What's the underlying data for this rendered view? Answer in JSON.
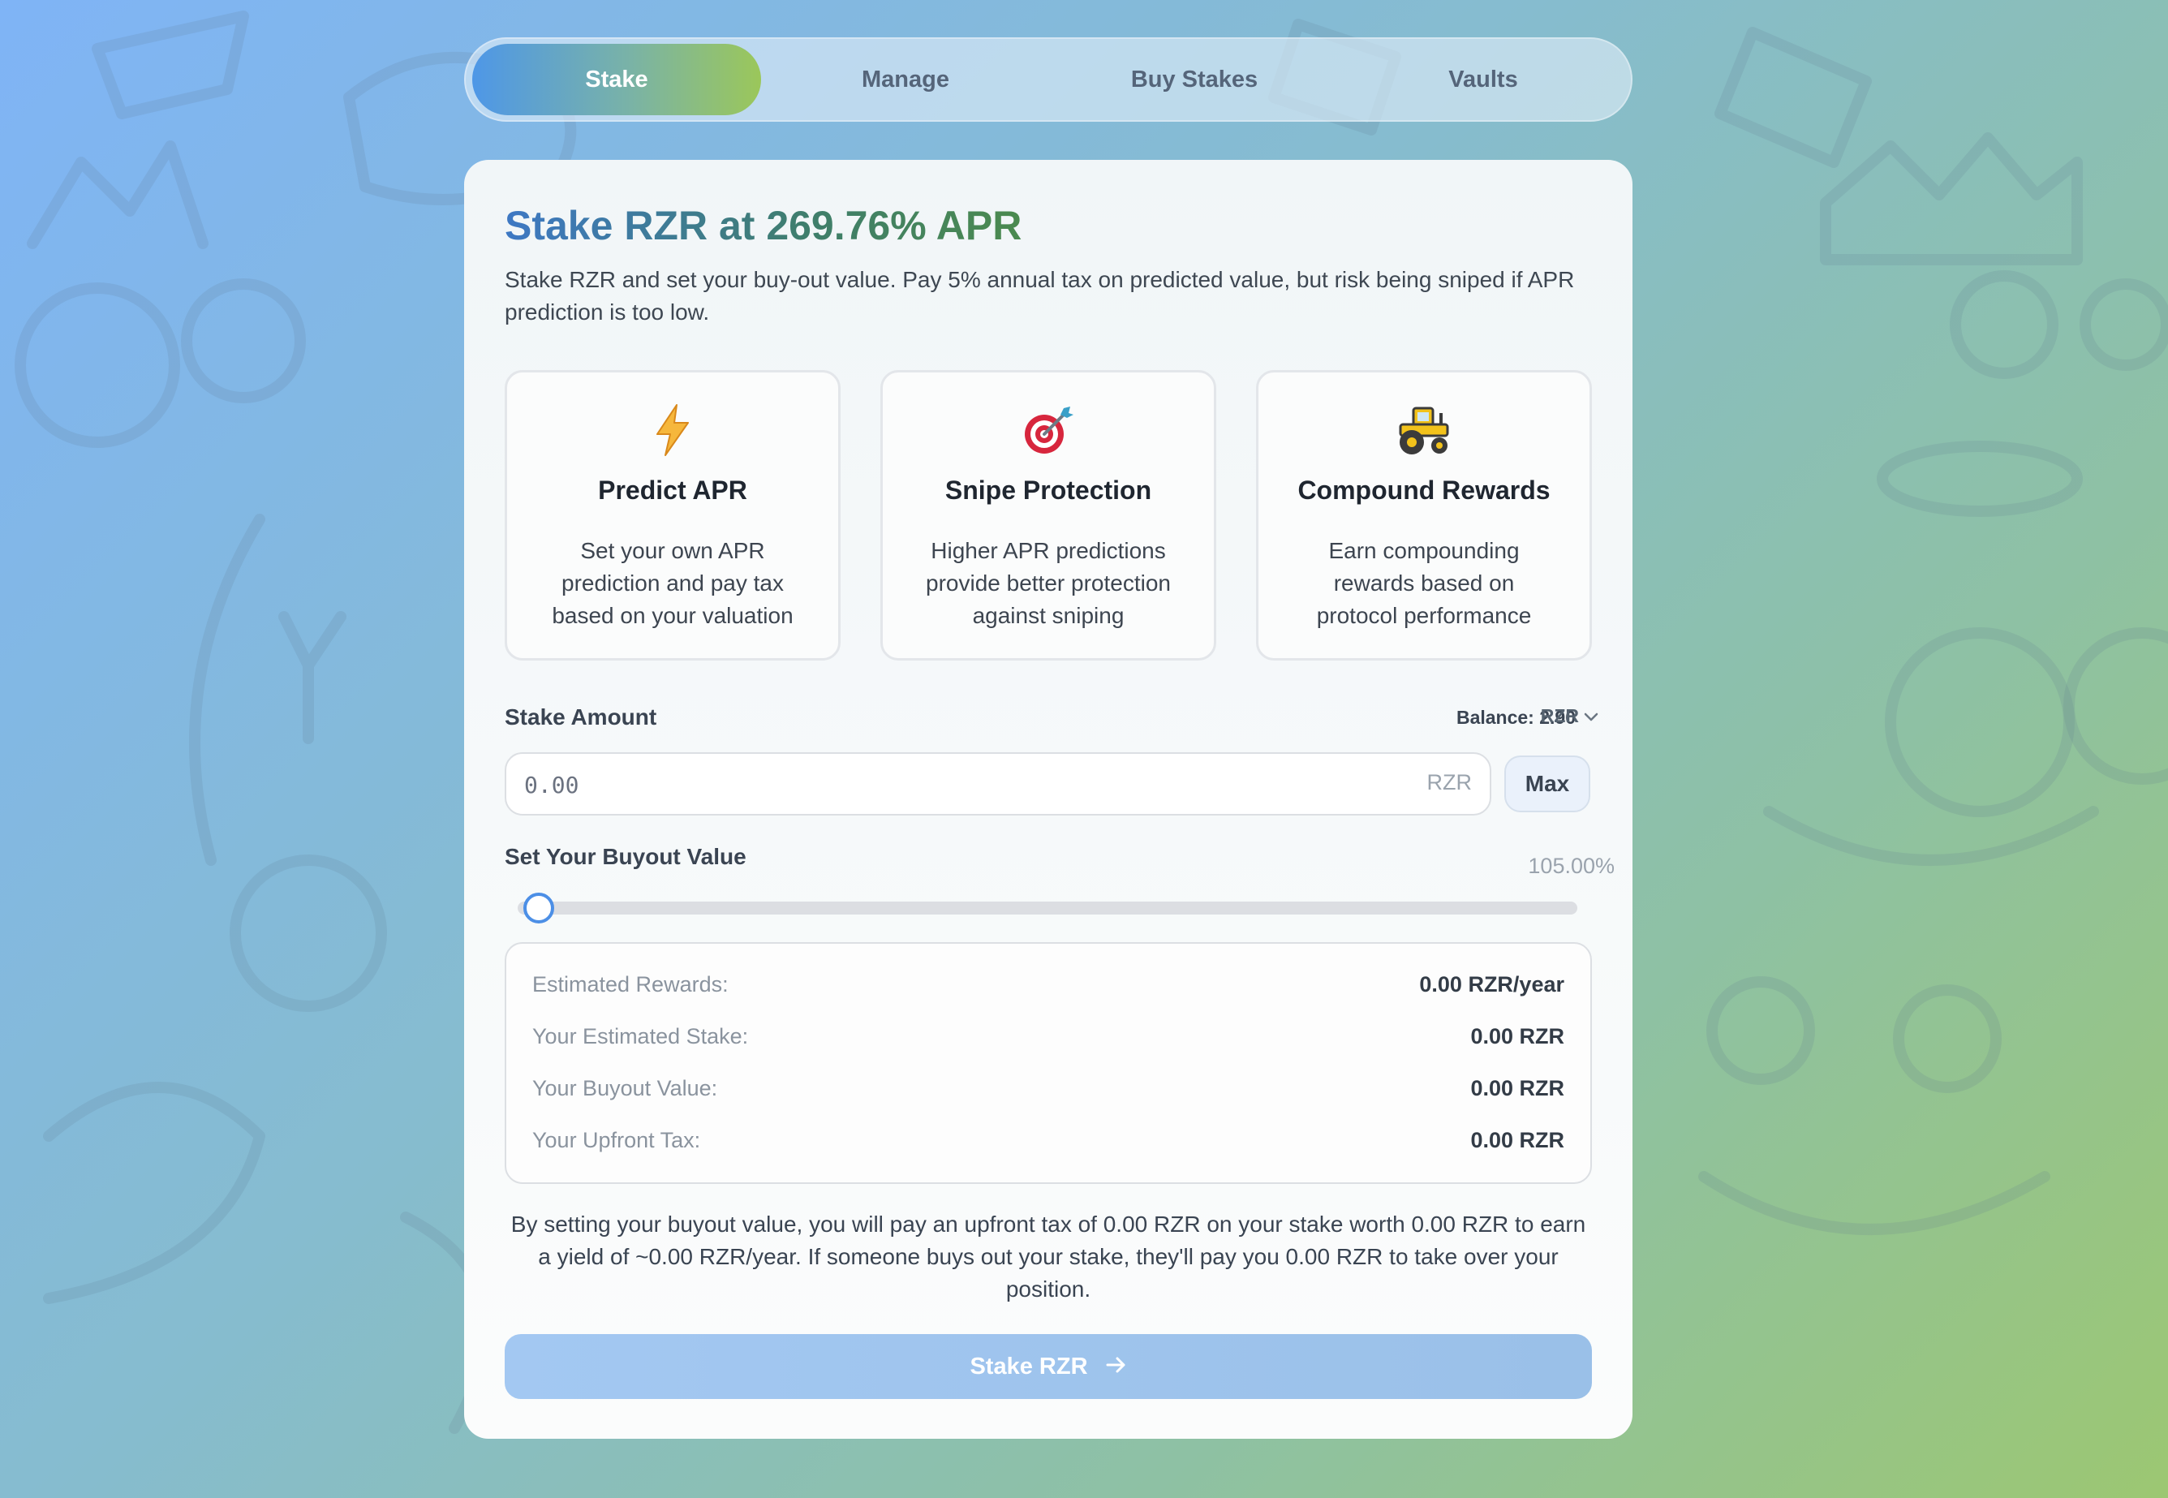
{
  "tabs": [
    {
      "label": "Stake",
      "active": true
    },
    {
      "label": "Manage",
      "active": false
    },
    {
      "label": "Buy Stakes",
      "active": false
    },
    {
      "label": "Vaults",
      "active": false
    }
  ],
  "stake": {
    "title": "Stake RZR at 269.76% APR",
    "description": "Stake RZR and set your buy-out value. Pay 5% annual tax on predicted value, but risk being sniped if APR prediction is too low.",
    "features": [
      {
        "icon": "lightning-icon",
        "title": "Predict APR",
        "text": "Set your own APR prediction and pay tax based on your valuation"
      },
      {
        "icon": "target-icon",
        "title": "Snipe Protection",
        "text": "Higher APR predictions provide better protection against sniping"
      },
      {
        "icon": "tractor-icon",
        "title": "Compound Rewards",
        "text": "Earn compounding rewards based on protocol performance"
      }
    ],
    "amount_label": "Stake Amount",
    "balance": "Balance: 2.90",
    "token": "RZR",
    "amount_placeholder": "0.00",
    "amount_unit": "RZR",
    "max_label": "Max",
    "buyout_label": "Set Your Buyout Value",
    "buyout_percent": "105.00%",
    "buyout_slider_fraction": 0.02,
    "summary": [
      {
        "label": "Estimated Rewards:",
        "value": "0.00 RZR/year"
      },
      {
        "label": "Your Estimated Stake:",
        "value": "0.00 RZR"
      },
      {
        "label": "Your Buyout Value:",
        "value": "0.00 RZR"
      },
      {
        "label": "Your Upfront Tax:",
        "value": "0.00 RZR"
      }
    ],
    "note": "By setting your buyout value, you will pay an upfront tax of 0.00 RZR on your stake worth 0.00 RZR to earn a yield of ~0.00 RZR/year. If someone buys out your stake, they'll pay you 0.00 RZR to take over your position.",
    "submit_label": "Stake RZR"
  },
  "colors": {
    "accent_blue": "#4e97e7",
    "accent_green": "#9bc75a",
    "button_disabled": "#a3c8f2"
  }
}
